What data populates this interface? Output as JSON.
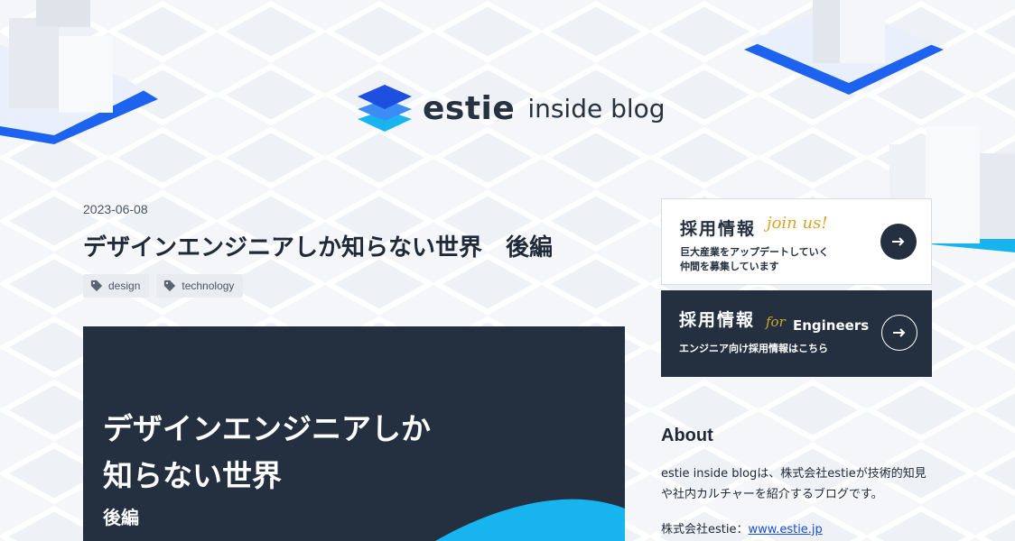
{
  "header": {
    "brand": "estie",
    "subtitle": "inside blog"
  },
  "post": {
    "date": "2023-06-08",
    "title": "デザインエンジニアしか知らない世界　後編",
    "tags": [
      {
        "label": "design",
        "icon": "tag-icon"
      },
      {
        "label": "technology",
        "icon": "tag-icon"
      }
    ],
    "hero": {
      "line1": "デザインエンジニアしか",
      "line2": "知らない世界",
      "line3": "後編"
    }
  },
  "sidebar": {
    "recruit_general": {
      "title": "採用情報",
      "script": "join us!",
      "line1": "巨大産業をアップデートしていく",
      "line2": "仲間を募集しています",
      "icon": "arrow-right-icon"
    },
    "recruit_engineers": {
      "title": "採用情報",
      "script": "for",
      "script_suffix": "Engineers",
      "line1": "エンジニア向け採用情報はこちら",
      "icon": "arrow-right-icon"
    },
    "about": {
      "title": "About",
      "text": "estie inside blogは、株式会社estieが技術的知見や社内カルチャーを紹介するブログです。",
      "company_label": "株式会社estie：",
      "company_link": "www.estie.jp"
    }
  },
  "colors": {
    "navy": "#243040",
    "brand_blue": "#1d63f0",
    "accent_cyan": "#18b4f0",
    "gold": "#d4a62a",
    "link": "#1a4fd6"
  }
}
